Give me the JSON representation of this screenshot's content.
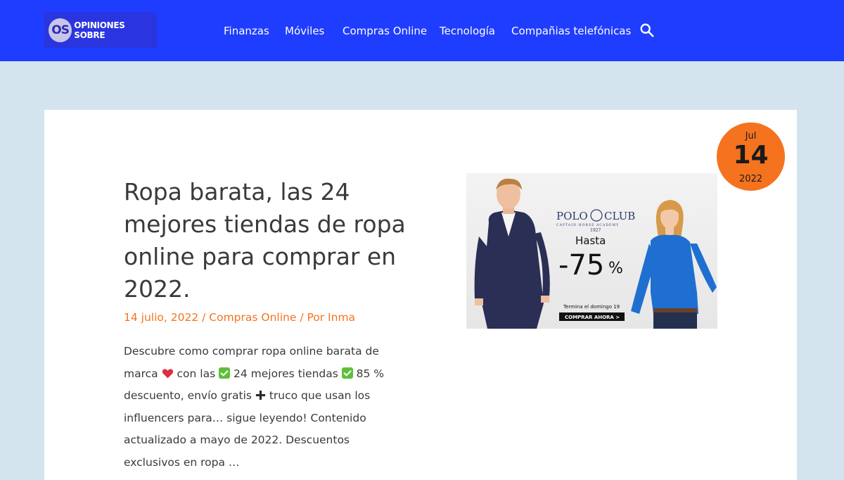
{
  "header": {
    "logo_initials": "OS",
    "logo_text": "OPINIONES SOBRE",
    "nav": [
      "Finanzas",
      "Móviles",
      "Compras Online",
      "Tecnología",
      "Compañias telefónicas"
    ]
  },
  "post": {
    "date": {
      "month": "Jul",
      "day": "14",
      "year": "2022"
    },
    "title": "Ropa barata, las 24 mejores tiendas de ropa online para comprar en 2022.",
    "meta": {
      "date": "14 julio, 2022",
      "sep1": " / ",
      "category": "Compras Online",
      "sep2": " / Por ",
      "author": "Inma"
    },
    "excerpt": {
      "p1": "Descubre como comprar ropa online barata de marca ",
      "p2": " con las ",
      "p3": " 24 mejores tiendas ",
      "p4": " 85 % descuento, envío gratis ",
      "p5": " truco que usan los influencers para… sigue leyendo! Contenido actualizado a mayo de 2022. Descuentos exclusivos en ropa …"
    }
  },
  "banner": {
    "brand_left": "POLO",
    "brand_right": "CLUB",
    "brand_sub": "CAPTAIN HORSE ACADEMY",
    "brand_year": "1927",
    "hasta": "Hasta",
    "discount": "-75",
    "percent": "%",
    "ends": "Termina el domingo 19",
    "cta": "COMPRAR AHORA >"
  },
  "colors": {
    "header_bg": "#1f3dff",
    "page_bg": "#d4e4ee",
    "accent": "#f5731e"
  }
}
